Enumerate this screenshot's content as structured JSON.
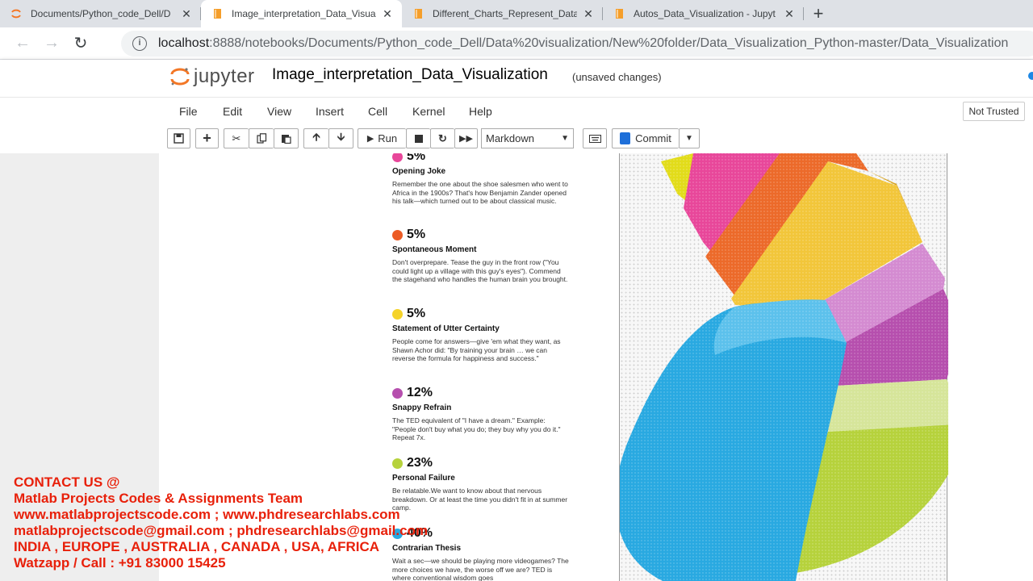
{
  "browser": {
    "tabs": [
      {
        "title": "Documents/Python_code_Dell/D",
        "active": false
      },
      {
        "title": "Image_interpretation_Data_Visua",
        "active": true
      },
      {
        "title": "Different_Charts_Represent_Data",
        "active": false
      },
      {
        "title": "Autos_Data_Visualization - Jupyt",
        "active": false
      }
    ],
    "close_glyph": "✕",
    "new_tab_glyph": "+",
    "url_host": "localhost",
    "url_rest": ":8888/notebooks/Documents/Python_code_Dell/Data%20visualization/New%20folder/Data_Visualization_Python-master/Data_Visualization"
  },
  "jupyter": {
    "logo_text": "jupyter",
    "notebook_name": "Image_interpretation_Data_Visualization",
    "save_status": "(unsaved changes)",
    "menu": [
      "File",
      "Edit",
      "View",
      "Insert",
      "Cell",
      "Kernel",
      "Help"
    ],
    "trust_label": "Not Trusted",
    "toolbar": {
      "run_label": "Run",
      "cell_type": "Markdown",
      "commit_label": "Commit"
    }
  },
  "infographic": {
    "items": [
      {
        "pct": "5%",
        "label": "Opening Joke",
        "body": "Remember the one about the shoe salesmen who went to Africa in the 1900s? That's how Benjamin Zander opened his talk—which turned out to be about classical music.",
        "color": "#e8479a"
      },
      {
        "pct": "5%",
        "label": "Spontaneous Moment",
        "body": "Don't overprepare. Tease the guy in the front row (\"You could light up a village with this guy's eyes\"). Commend the stagehand who handles the human brain you brought.",
        "color": "#ec5b24"
      },
      {
        "pct": "5%",
        "label": "Statement of Utter Certainty",
        "body": "People come for answers—give 'em what they want, as Shawn Achor did: \"By training your brain … we can reverse the formula for happiness and success.\"",
        "color": "#f5d329"
      },
      {
        "pct": "12%",
        "label": "Snappy Refrain",
        "body": "The TED equivalent of \"I have a dream.\" Example: \"People don't buy what you do; they buy why you do it.\" Repeat 7x.",
        "color": "#b64fae"
      },
      {
        "pct": "23%",
        "label": "Personal Failure",
        "body": "Be relatable.We want to know about that nervous breakdown. Or at least the time you didn't fit in at summer camp.",
        "color": "#b6d23c"
      },
      {
        "pct": "40%",
        "label": "Contrarian Thesis",
        "body": "Wait a sec—we should be playing more videogames? The more choices we have, the worse off we are? TED is where conventional wisdom goes",
        "color": "#29a9e1"
      }
    ],
    "slice_colors": [
      "#e2dc1a",
      "#e8479a",
      "#ec6a2a",
      "#f2c63a",
      "#c46bc0",
      "#b6d23c",
      "#29a9e1"
    ]
  },
  "overlay": {
    "lines": [
      "CONTACT US @",
      "Matlab Projects Codes & Assignments Team",
      "www.matlabprojectscode.com ; www.phdresearchlabs.com",
      "matlabprojectscode@gmail.com ; phdresearchlabs@gmail.com",
      "INDIA , EUROPE , AUSTRALIA , CANADA , USA, AFRICA",
      "Watzapp / Call : +91 83000 15425"
    ],
    "color": "#e8200a"
  }
}
